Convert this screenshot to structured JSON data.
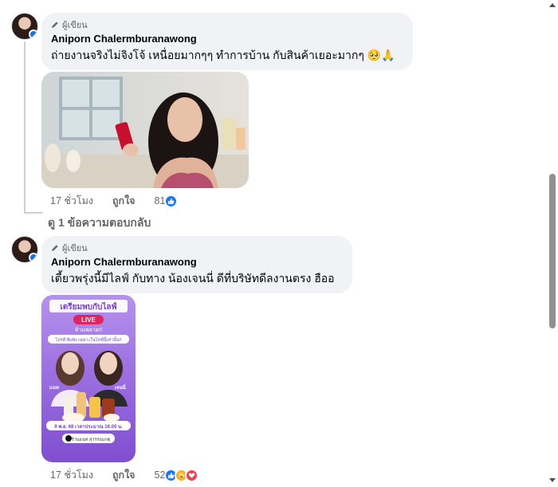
{
  "comments": [
    {
      "author_role": "ผู้เขียน",
      "author_name": "Aniporn Chalermburanawong",
      "text": "ถ่ายงานจริงไม่จิงโจ้ เหนื่อยมากๆๆ ทำการบ้าน กับสินค้าเยอะมากๆ 🥺🙏",
      "time": "17 ชั่วโมง",
      "like_label": "ถูกใจ",
      "reaction_count": "81",
      "reactions": [
        "like-icon"
      ]
    },
    {
      "author_role": "ผู้เขียน",
      "author_name": "Aniporn Chalermburanawong",
      "text": "เตี้ยวพรุ่งนี้มีไลฟ์ กับทาง น้องเจนนี่ ดีที่บริษัทดีลงานตรง ฮืออ",
      "time": "17 ชั่วโมง",
      "like_label": "ถูกใจ",
      "reaction_count": "52",
      "reactions": [
        "like-icon",
        "care-icon",
        "love-icon"
      ]
    }
  ],
  "view_replies_label": "ดู 1 ข้อความตอบกลับ",
  "poster": {
    "headline": "เตรียมพบกับไลฟ์",
    "live_label": "LIVE",
    "subline": "ห้ามพลาด!!",
    "promo": "โปรดี พิเศษ เฉพาะในไลฟ์นี้เท่านั้น!!",
    "name_left": "แนท",
    "name_right": "เจนนี่",
    "date_line": "9 พ.ย. 68 เวลาประมาณ 16.00 น.",
    "tiktok_label": "ร้านแนท สุวรรณเกตุ"
  },
  "colors": {
    "bubble_bg": "#f0f2f5",
    "secondary_text": "#65676b",
    "like_blue": "#1877f2",
    "poster_purple": "#8e5fd8"
  }
}
